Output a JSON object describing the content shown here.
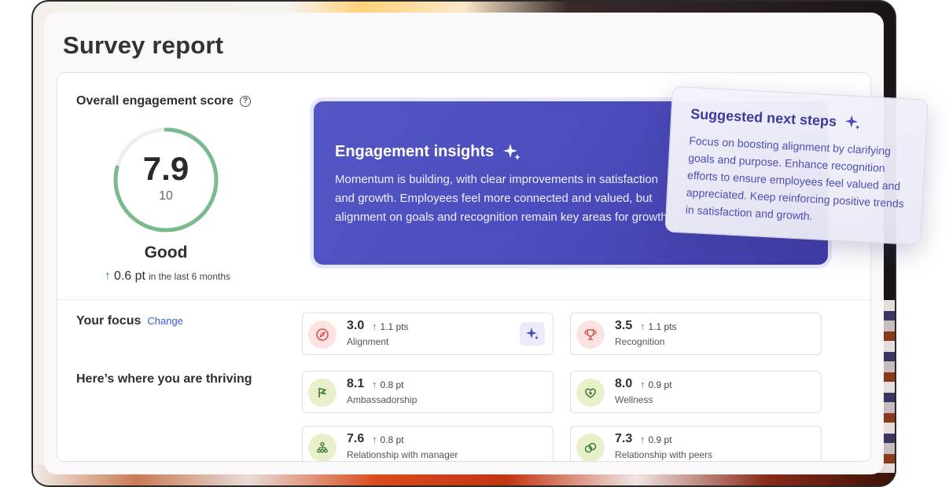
{
  "page": {
    "title": "Survey report"
  },
  "score": {
    "title": "Overall engagement score",
    "value": "7.9",
    "max": "10",
    "fraction": 0.79,
    "label": "Good",
    "change_value": "0.6 pt",
    "change_text": "in the last 6 months"
  },
  "insights": {
    "title": "Engagement insights",
    "body": "Momentum is building, with clear improvements in satisfaction and growth. Employees feel more connected and valued, but alignment on goals and recognition remain key areas for growth."
  },
  "next_steps": {
    "title": "Suggested next steps",
    "body": "Focus on boosting alignment by clarifying goals and purpose. Enhance recognition efforts to ensure employees feel valued and appreciated. Keep reinforcing positive trends in satisfaction and growth."
  },
  "focus": {
    "label": "Your focus",
    "change_link": "Change",
    "items": [
      {
        "value": "3.0",
        "delta": "1.1 pts",
        "name": "Alignment",
        "icon": "compass-icon"
      },
      {
        "value": "3.5",
        "delta": "1.1 pts",
        "name": "Recognition",
        "icon": "trophy-icon"
      }
    ]
  },
  "thriving": {
    "label": "Here’s where you are thriving",
    "items": [
      {
        "value": "8.1",
        "delta": "0.8 pt",
        "name": "Ambassadorship",
        "icon": "flag-icon"
      },
      {
        "value": "8.0",
        "delta": "0.9 pt",
        "name": "Wellness",
        "icon": "heart-plus-icon"
      },
      {
        "value": "7.6",
        "delta": "0.8 pt",
        "name": "Relationship with manager",
        "icon": "team-icon"
      },
      {
        "value": "7.3",
        "delta": "0.9 pt",
        "name": "Relationship with peers",
        "icon": "link-icon"
      }
    ]
  },
  "colors": {
    "ring": "#7bb98e",
    "accent": "#4b4cbd",
    "positive": "#2e8a6e",
    "link": "#3b5bdb"
  }
}
